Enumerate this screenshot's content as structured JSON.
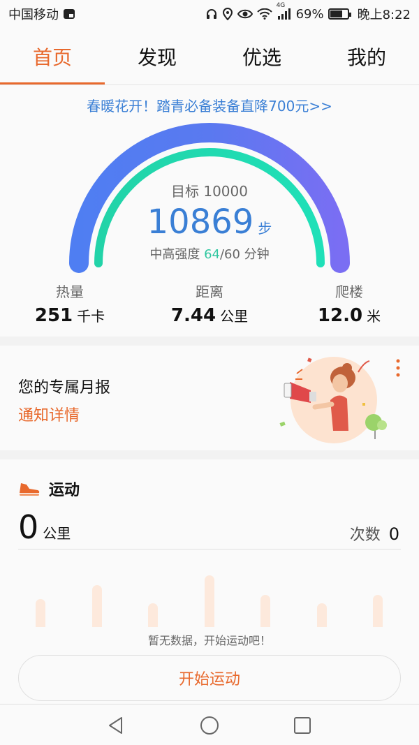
{
  "status_bar": {
    "carrier": "中国移动",
    "battery_percent": "69%",
    "battery_level": 0.69,
    "network_label": "4G",
    "time": "晚上8:22",
    "icons": [
      "sim-card-icon",
      "headset-icon",
      "location-icon",
      "eye-icon",
      "wifi-icon",
      "signal-icon",
      "battery-icon"
    ]
  },
  "tabs": [
    {
      "label": "首页",
      "active": true
    },
    {
      "label": "发现",
      "active": false
    },
    {
      "label": "优选",
      "active": false
    },
    {
      "label": "我的",
      "active": false
    }
  ],
  "home": {
    "promo_text": "春暖花开！踏青必备装备直降700元>>",
    "goal_text": "目标 10000",
    "steps": "10869",
    "steps_unit": "步",
    "goal_progress": 1.0,
    "intensity_prefix": "中高强度 ",
    "intensity_value": "64",
    "intensity_suffix": "/60 分钟",
    "intensity_progress": 1.0,
    "stats": [
      {
        "label": "热量",
        "value": "251",
        "unit": "千卡"
      },
      {
        "label": "距离",
        "value": "7.44",
        "unit": "公里"
      },
      {
        "label": "爬楼",
        "value": "12.0",
        "unit": "米"
      }
    ]
  },
  "report": {
    "title": "您的专属月报",
    "link": "通知详情"
  },
  "sport": {
    "title": "运动",
    "distance": "0",
    "distance_unit": "公里",
    "count_label": "次数",
    "count_value": "0",
    "empty_text": "暂无数据，开始运动吧！",
    "start_button": "开始运动"
  },
  "colors": {
    "accent": "#e8692d",
    "blue": "#3a7fd5",
    "green": "#2fc7a0"
  }
}
